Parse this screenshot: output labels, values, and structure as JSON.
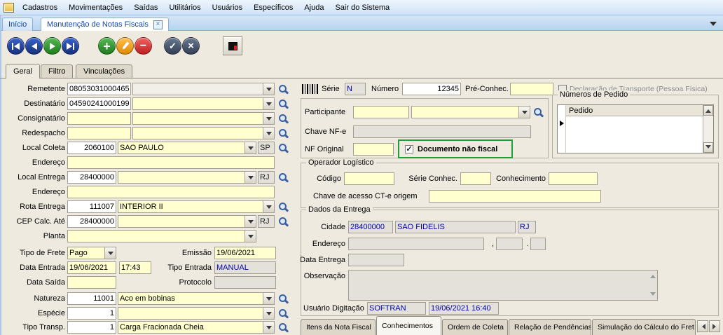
{
  "menu": {
    "items": [
      "Cadastros",
      "Movimentações",
      "Saídas",
      "Utilitários",
      "Usuários",
      "Específicos",
      "Ajuda",
      "Sair do Sistema"
    ]
  },
  "doc_tabs": {
    "inicio": "Início",
    "active": "Manutenção de Notas Fiscais"
  },
  "page_tabs": {
    "items": [
      "Geral",
      "Filtro",
      "Vinculações"
    ],
    "active": "Geral"
  },
  "toolbar": {
    "buttons": [
      "first-record",
      "previous-record",
      "next-record",
      "last-record",
      "add",
      "edit",
      "delete",
      "confirm",
      "cancel",
      "device"
    ]
  },
  "form": {
    "remetente": {
      "label": "Remetente",
      "code": "08053031000465",
      "name": ""
    },
    "destinatario": {
      "label": "Destinatário",
      "code": "04590241000199",
      "name": ""
    },
    "consignatario": {
      "label": "Consignatário",
      "code": "",
      "name": ""
    },
    "redespacho": {
      "label": "Redespacho",
      "code": "",
      "name": ""
    },
    "local_coleta": {
      "label": "Local Coleta",
      "code": "2060100",
      "name": "SAO PAULO",
      "uf": "SP"
    },
    "endereco_coleta": {
      "label": "Endereço",
      "value": ""
    },
    "local_entrega": {
      "label": "Local Entrega",
      "code": "28400000",
      "name": "",
      "uf": "RJ"
    },
    "endereco_entrega": {
      "label": "Endereço",
      "value": ""
    },
    "rota_entrega": {
      "label": "Rota Entrega",
      "code": "111007",
      "name": "INTERIOR II"
    },
    "cep_calc_ate": {
      "label": "CEP Calc. Até",
      "code": "28400000",
      "name": "",
      "uf": "RJ"
    },
    "planta": {
      "label": "Planta",
      "value": ""
    },
    "tipo_frete": {
      "label": "Tipo de Frete",
      "value": "Pago"
    },
    "emissao": {
      "label": "Emissão",
      "value": "19/06/2021"
    },
    "data_entrada": {
      "label": "Data Entrada",
      "date": "19/06/2021",
      "time": "17:43"
    },
    "tipo_entrada": {
      "label": "Tipo Entrada",
      "value": "MANUAL"
    },
    "data_saida": {
      "label": "Data Saída",
      "value": ""
    },
    "protocolo": {
      "label": "Protocolo",
      "value": ""
    },
    "natureza": {
      "label": "Natureza",
      "code": "11001",
      "name": "Aco em bobinas"
    },
    "especie": {
      "label": "Espécie",
      "code": "1",
      "name": ""
    },
    "tipo_transp": {
      "label": "Tipo Transp.",
      "code": "1",
      "name": "Carga Fracionada Cheia"
    }
  },
  "nota": {
    "serie": {
      "label": "Série",
      "value": "N"
    },
    "numero": {
      "label": "Número",
      "value": "12345"
    },
    "pre_conhec": {
      "label": "Pré-Conhec.",
      "value": ""
    },
    "declaracao_transporte": {
      "label": "Declaração de Transporte (Pessoa Física)",
      "checked": false
    },
    "participante": {
      "label": "Participante",
      "code": "",
      "name": ""
    },
    "chave_nfe": {
      "label": "Chave NF-e",
      "value": ""
    },
    "nf_original": {
      "label": "NF Original",
      "value": ""
    },
    "documento_nao_fiscal": {
      "label": "Documento não fiscal",
      "checked": true
    }
  },
  "pedidos": {
    "title": "Números de Pedido",
    "column": "Pedido",
    "rows": []
  },
  "operador_logistico": {
    "title": "Operador Logístico",
    "codigo": {
      "label": "Código",
      "value": ""
    },
    "serie_conhec": {
      "label": "Série Conhec.",
      "value": ""
    },
    "conhecimento": {
      "label": "Conhecimento",
      "value": ""
    },
    "chave_cte": {
      "label": "Chave de acesso CT-e origem",
      "value": ""
    }
  },
  "dados_entrega": {
    "title": "Dados da Entrega",
    "cidade": {
      "label": "Cidade",
      "code": "28400000",
      "name": "SAO FIDELIS",
      "uf": "RJ"
    },
    "endereco": {
      "label": "Endereço",
      "logradouro": "",
      "sep1": ",",
      "numero": "",
      "sep2": ".",
      "complemento": ""
    },
    "data_entrega": {
      "label": "Data Entrega",
      "value": ""
    },
    "observacao": {
      "label": "Observação",
      "value": ""
    },
    "usuario_digitacao": {
      "label": "Usuário Digitação",
      "usuario": "SOFTRAN",
      "datahora": "19/06/2021 16:40"
    }
  },
  "bottom_tabs": {
    "items": [
      "Itens da Nota Fiscal",
      "Conhecimentos",
      "Ordem de Coleta",
      "Relação de Pendências",
      "Simulação do Cálculo do Fret"
    ],
    "active": "Conhecimentos"
  }
}
